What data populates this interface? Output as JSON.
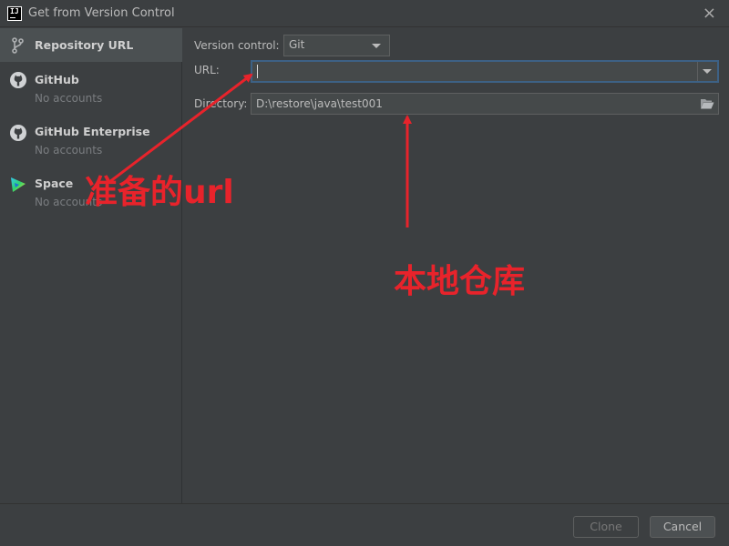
{
  "window": {
    "title": "Get from Version Control",
    "app_icon_text": "IJ",
    "close_glyph": "×"
  },
  "sidebar": {
    "items": [
      {
        "title": "Repository URL",
        "subtitle": "",
        "icon": "branch-icon",
        "selected": true
      },
      {
        "title": "GitHub",
        "subtitle": "No accounts",
        "icon": "github-icon",
        "selected": false
      },
      {
        "title": "GitHub Enterprise",
        "subtitle": "No accounts",
        "icon": "github-icon",
        "selected": false
      },
      {
        "title": "Space",
        "subtitle": "No accounts",
        "icon": "space-icon",
        "selected": false
      }
    ]
  },
  "form": {
    "vcs_label": "Version control:",
    "vcs_value": "Git",
    "url_label": "URL:",
    "url_value": "",
    "dir_label": "Directory:",
    "dir_value": "D:\\restore\\java\\test001"
  },
  "footer": {
    "clone_label": "Clone",
    "cancel_label": "Cancel"
  },
  "annotations": {
    "url_note": "准备的url",
    "repo_note": "本地仓库",
    "color": "#e8232b"
  },
  "colors": {
    "background": "#3c3f41",
    "selected": "#4b5052",
    "focus_border": "#3d6185",
    "input_bg": "#45494a"
  }
}
